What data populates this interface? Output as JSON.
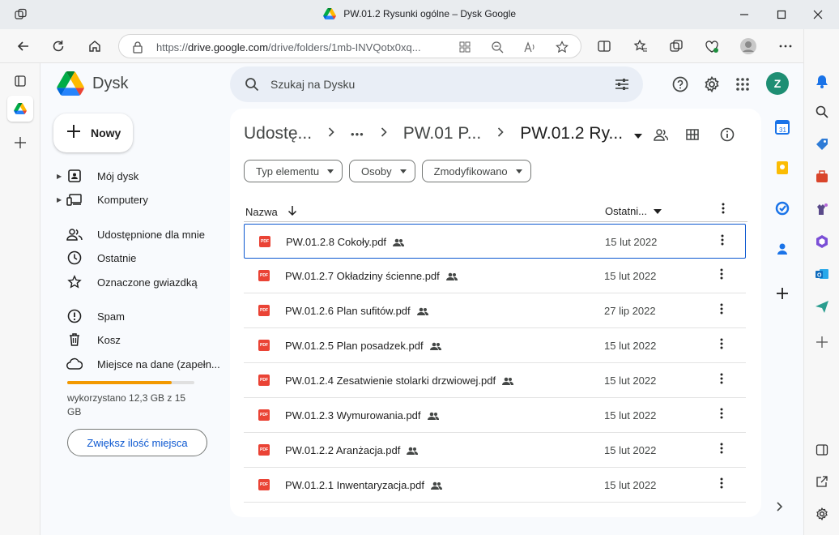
{
  "window": {
    "title": "PW.01.2 Rysunki ogólne – Dysk Google",
    "minimize_icon": "minimize-icon",
    "maximize_icon": "maximize-icon",
    "close_icon": "close-icon"
  },
  "browser": {
    "url_prefix": "https://",
    "url_host": "drive.google.com",
    "url_path": "/drive/folders/1mb-INVQotx0xq..."
  },
  "app": {
    "name": "Dysk",
    "search_placeholder": "Szukaj na Dysku",
    "avatar_letter": "Z",
    "avatar_color": "#1e8e73"
  },
  "new_button": {
    "label": "Nowy"
  },
  "sidebar": {
    "items": [
      {
        "label": "Mój dysk",
        "icon": "drive-icon"
      },
      {
        "label": "Komputery",
        "icon": "computer-icon"
      },
      {
        "label": "Udostępnione dla mnie",
        "icon": "shared-people-icon"
      },
      {
        "label": "Ostatnie",
        "icon": "clock-icon"
      },
      {
        "label": "Oznaczone gwiazdką",
        "icon": "star-icon"
      },
      {
        "label": "Spam",
        "icon": "spam-icon"
      },
      {
        "label": "Kosz",
        "icon": "trash-icon"
      },
      {
        "label": "Miejsce na dane (zapełn...",
        "icon": "cloud-icon"
      }
    ],
    "storage": {
      "used_fraction": 0.82,
      "text": "wykorzystano 12,3 GB z 15 GB",
      "button": "Zwiększ ilość miejsca",
      "bar_color": "#f29900"
    }
  },
  "breadcrumb": {
    "items": [
      "Udostę...",
      "•••",
      "PW.01 P...",
      "PW.01.2 Ry..."
    ]
  },
  "filters": [
    "Typ elementu",
    "Osoby",
    "Zmodyfikowano"
  ],
  "table": {
    "col_name": "Nazwa",
    "col_modified": "Ostatni...",
    "rows": [
      {
        "name": "PW.01.2.8 Cokoły.pdf",
        "date": "15 lut 2022"
      },
      {
        "name": "PW.01.2.7 Okładziny ścienne.pdf",
        "date": "15 lut 2022"
      },
      {
        "name": "PW.01.2.6 Plan sufitów.pdf",
        "date": "27 lip 2022"
      },
      {
        "name": "PW.01.2.5 Plan posadzek.pdf",
        "date": "15 lut 2022"
      },
      {
        "name": "PW.01.2.4 Zesatwienie stolarki drzwiowej.pdf",
        "date": "15 lut 2022"
      },
      {
        "name": "PW.01.2.3 Wymurowania.pdf",
        "date": "15 lut 2022"
      },
      {
        "name": "PW.01.2.2 Aranżacja.pdf",
        "date": "15 lut 2022"
      },
      {
        "name": "PW.01.2.1 Inwentaryzacja.pdf",
        "date": "15 lut 2022"
      }
    ],
    "file_badge": "PDF"
  }
}
